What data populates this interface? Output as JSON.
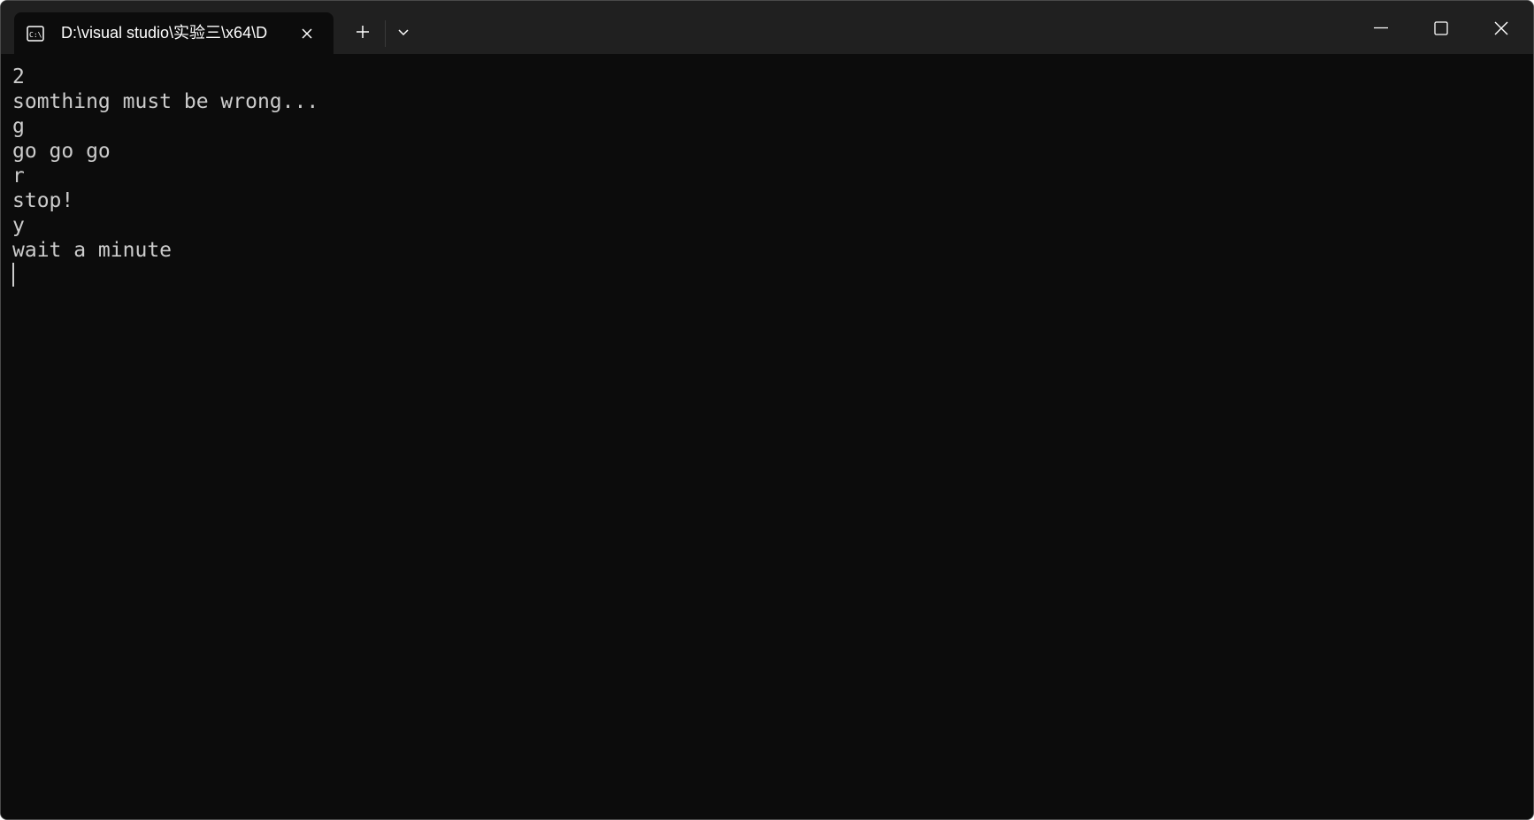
{
  "window": {
    "tab_title": "D:\\visual studio\\实验三\\x64\\D",
    "tab_icon": "terminal-icon",
    "new_tab_icon": "plus-icon",
    "dropdown_icon": "chevron-down-icon",
    "caption_icons": [
      "minimize-icon",
      "maximize-icon",
      "close-icon"
    ]
  },
  "terminal": {
    "lines": [
      "2",
      "somthing must be wrong...",
      "g",
      "go go go",
      "r",
      "stop!",
      "y",
      "wait a minute"
    ]
  },
  "colors": {
    "titlebar_bg": "#202020",
    "terminal_bg": "#0c0c0c",
    "text": "#cccccc"
  }
}
